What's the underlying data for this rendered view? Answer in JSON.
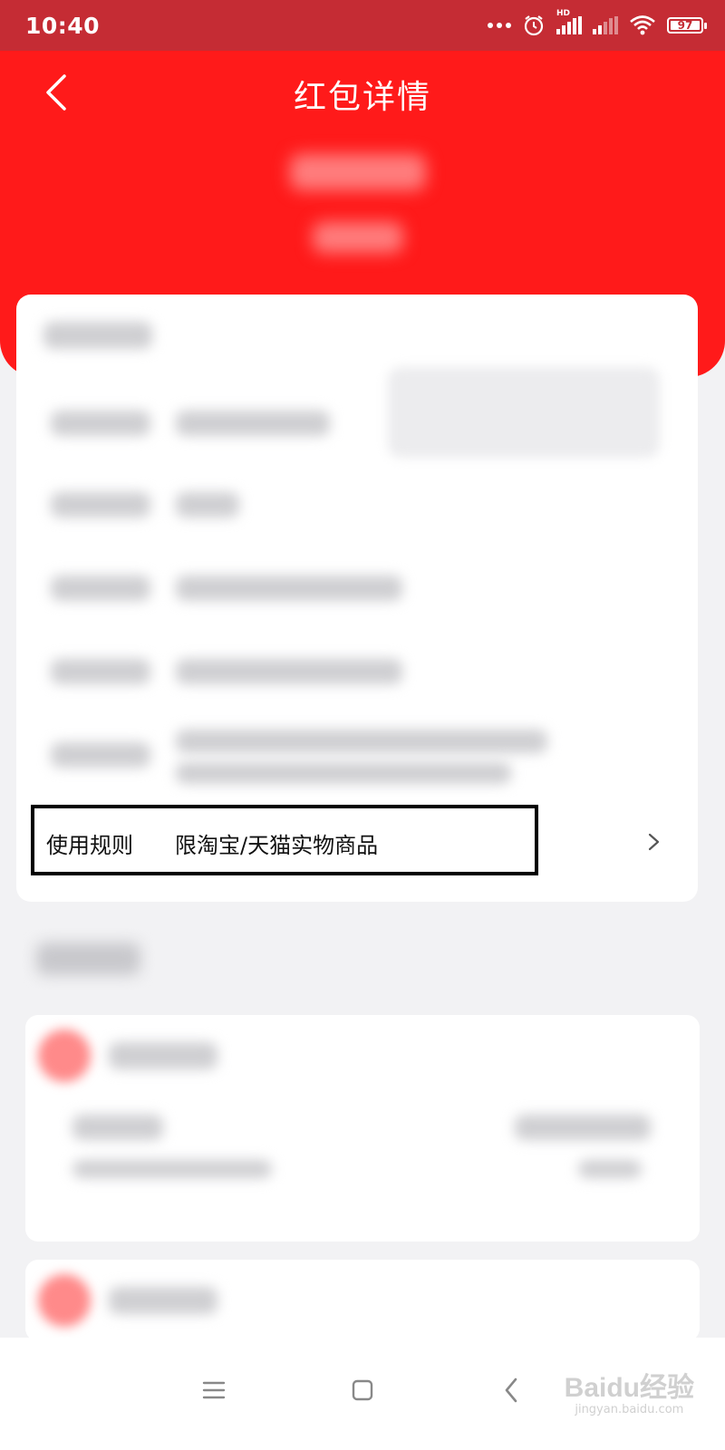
{
  "status_bar": {
    "time": "10:40",
    "network_label": "HD",
    "battery_level": "97"
  },
  "header": {
    "title": "红包详情",
    "back_icon": "chevron-left-icon"
  },
  "usage_rule": {
    "label": "使用规则",
    "value": "限淘宝/天猫实物商品",
    "arrow_icon": "chevron-right-icon"
  },
  "system_nav": {
    "menu_icon": "menu-icon",
    "home_icon": "square-home-icon",
    "back_icon": "triangle-back-icon"
  },
  "watermark": {
    "brand": "Baidu经验",
    "url": "jingyan.baidu.com"
  },
  "colors": {
    "header_red": "#ff1a1a",
    "status_bar_red": "#c52c34",
    "highlight_border": "#000000"
  }
}
